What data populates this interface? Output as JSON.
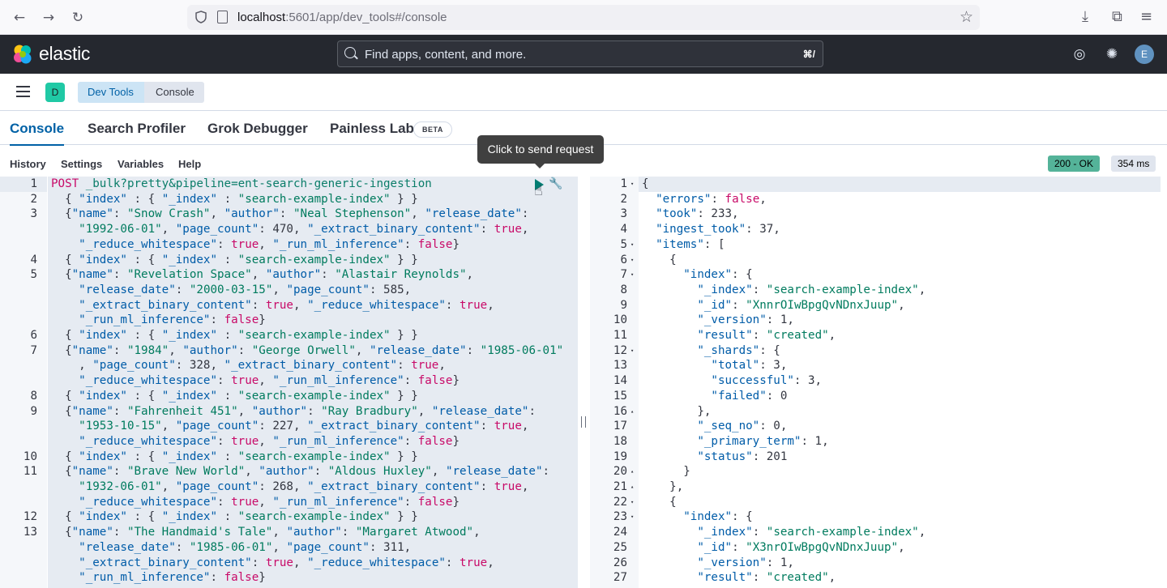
{
  "browser": {
    "url_host": "localhost",
    "url_rest": ":5601/app/dev_tools#/console"
  },
  "header": {
    "logo_text": "elastic",
    "search_placeholder": "Find apps, content, and more.",
    "search_shortcut": "⌘/",
    "avatar_initial": "E"
  },
  "breadcrumb": {
    "space_initial": "D",
    "items": [
      "Dev Tools",
      "Console"
    ]
  },
  "tabs": [
    {
      "label": "Console",
      "active": true
    },
    {
      "label": "Search Profiler",
      "active": false
    },
    {
      "label": "Grok Debugger",
      "active": false
    },
    {
      "label": "Painless Lab",
      "active": false
    }
  ],
  "beta_badge": "BETA",
  "console_menu": [
    "History",
    "Settings",
    "Variables",
    "Help"
  ],
  "tooltip": "Click to send request",
  "status": {
    "code": "200 - OK",
    "time": "354 ms"
  },
  "request_lines": [
    {
      "num": "1",
      "html": "<span class='m'>POST</span> <span class='url'>_bulk?pretty&pipeline=ent-search-generic-ingestion</span>"
    },
    {
      "num": "2",
      "html": "  { <span class='n'>\"index\"</span> : { <span class='n'>\"_index\"</span> : <span class='s'>\"search-example-index\"</span> } }"
    },
    {
      "num": "3",
      "html": "  {<span class='n'>\"name\"</span>: <span class='s'>\"Snow Crash\"</span>, <span class='n'>\"author\"</span>: <span class='s'>\"Neal Stephenson\"</span>, <span class='n'>\"release_date\"</span>:"
    },
    {
      "num": "",
      "html": "    <span class='s'>\"1992-06-01\"</span>, <span class='n'>\"page_count\"</span>: 470, <span class='n'>\"_extract_binary_content\"</span>: <span class='b'>true</span>,"
    },
    {
      "num": "",
      "html": "    <span class='n'>\"_reduce_whitespace\"</span>: <span class='b'>true</span>, <span class='n'>\"_run_ml_inference\"</span>: <span class='b'>false</span>}"
    },
    {
      "num": "4",
      "html": "  { <span class='n'>\"index\"</span> : { <span class='n'>\"_index\"</span> : <span class='s'>\"search-example-index\"</span> } }"
    },
    {
      "num": "5",
      "html": "  {<span class='n'>\"name\"</span>: <span class='s'>\"Revelation Space\"</span>, <span class='n'>\"author\"</span>: <span class='s'>\"Alastair Reynolds\"</span>,"
    },
    {
      "num": "",
      "html": "    <span class='n'>\"release_date\"</span>: <span class='s'>\"2000-03-15\"</span>, <span class='n'>\"page_count\"</span>: 585,"
    },
    {
      "num": "",
      "html": "    <span class='n'>\"_extract_binary_content\"</span>: <span class='b'>true</span>, <span class='n'>\"_reduce_whitespace\"</span>: <span class='b'>true</span>,"
    },
    {
      "num": "",
      "html": "    <span class='n'>\"_run_ml_inference\"</span>: <span class='b'>false</span>}"
    },
    {
      "num": "6",
      "html": "  { <span class='n'>\"index\"</span> : { <span class='n'>\"_index\"</span> : <span class='s'>\"search-example-index\"</span> } }"
    },
    {
      "num": "7",
      "html": "  {<span class='n'>\"name\"</span>: <span class='s'>\"1984\"</span>, <span class='n'>\"author\"</span>: <span class='s'>\"George Orwell\"</span>, <span class='n'>\"release_date\"</span>: <span class='s'>\"1985-06-01\"</span>"
    },
    {
      "num": "",
      "html": "    , <span class='n'>\"page_count\"</span>: 328, <span class='n'>\"_extract_binary_content\"</span>: <span class='b'>true</span>,"
    },
    {
      "num": "",
      "html": "    <span class='n'>\"_reduce_whitespace\"</span>: <span class='b'>true</span>, <span class='n'>\"_run_ml_inference\"</span>: <span class='b'>false</span>}"
    },
    {
      "num": "8",
      "html": "  { <span class='n'>\"index\"</span> : { <span class='n'>\"_index\"</span> : <span class='s'>\"search-example-index\"</span> } }"
    },
    {
      "num": "9",
      "html": "  {<span class='n'>\"name\"</span>: <span class='s'>\"Fahrenheit 451\"</span>, <span class='n'>\"author\"</span>: <span class='s'>\"Ray Bradbury\"</span>, <span class='n'>\"release_date\"</span>:"
    },
    {
      "num": "",
      "html": "    <span class='s'>\"1953-10-15\"</span>, <span class='n'>\"page_count\"</span>: 227, <span class='n'>\"_extract_binary_content\"</span>: <span class='b'>true</span>,"
    },
    {
      "num": "",
      "html": "    <span class='n'>\"_reduce_whitespace\"</span>: <span class='b'>true</span>, <span class='n'>\"_run_ml_inference\"</span>: <span class='b'>false</span>}"
    },
    {
      "num": "10",
      "html": "  { <span class='n'>\"index\"</span> : { <span class='n'>\"_index\"</span> : <span class='s'>\"search-example-index\"</span> } }"
    },
    {
      "num": "11",
      "html": "  {<span class='n'>\"name\"</span>: <span class='s'>\"Brave New World\"</span>, <span class='n'>\"author\"</span>: <span class='s'>\"Aldous Huxley\"</span>, <span class='n'>\"release_date\"</span>:"
    },
    {
      "num": "",
      "html": "    <span class='s'>\"1932-06-01\"</span>, <span class='n'>\"page_count\"</span>: 268, <span class='n'>\"_extract_binary_content\"</span>: <span class='b'>true</span>,"
    },
    {
      "num": "",
      "html": "    <span class='n'>\"_reduce_whitespace\"</span>: <span class='b'>true</span>, <span class='n'>\"_run_ml_inference\"</span>: <span class='b'>false</span>}"
    },
    {
      "num": "12",
      "html": "  { <span class='n'>\"index\"</span> : { <span class='n'>\"_index\"</span> : <span class='s'>\"search-example-index\"</span> } }"
    },
    {
      "num": "13",
      "html": "  {<span class='n'>\"name\"</span>: <span class='s'>\"The Handmaid's Tale\"</span>, <span class='n'>\"author\"</span>: <span class='s'>\"Margaret Atwood\"</span>,"
    },
    {
      "num": "",
      "html": "    <span class='n'>\"release_date\"</span>: <span class='s'>\"1985-06-01\"</span>, <span class='n'>\"page_count\"</span>: 311,"
    },
    {
      "num": "",
      "html": "    <span class='n'>\"_extract_binary_content\"</span>: <span class='b'>true</span>, <span class='n'>\"_reduce_whitespace\"</span>: <span class='b'>true</span>,"
    },
    {
      "num": "",
      "html": "    <span class='n'>\"_run_ml_inference\"</span>: <span class='b'>false</span>}"
    }
  ],
  "response_lines": [
    {
      "num": "1",
      "fold": "▾",
      "html": "{"
    },
    {
      "num": "2",
      "fold": "",
      "html": "  <span class='n'>\"errors\"</span>: <span class='b'>false</span>,"
    },
    {
      "num": "3",
      "fold": "",
      "html": "  <span class='n'>\"took\"</span>: 233,"
    },
    {
      "num": "4",
      "fold": "",
      "html": "  <span class='n'>\"ingest_took\"</span>: 37,"
    },
    {
      "num": "5",
      "fold": "▾",
      "html": "  <span class='n'>\"items\"</span>: ["
    },
    {
      "num": "6",
      "fold": "▾",
      "html": "    {"
    },
    {
      "num": "7",
      "fold": "▾",
      "html": "      <span class='n'>\"index\"</span>: {"
    },
    {
      "num": "8",
      "fold": "",
      "html": "        <span class='n'>\"_index\"</span>: <span class='s'>\"search-example-index\"</span>,"
    },
    {
      "num": "9",
      "fold": "",
      "html": "        <span class='n'>\"_id\"</span>: <span class='s'>\"XnnrOIwBpgQvNDnxJuup\"</span>,"
    },
    {
      "num": "10",
      "fold": "",
      "html": "        <span class='n'>\"_version\"</span>: 1,"
    },
    {
      "num": "11",
      "fold": "",
      "html": "        <span class='n'>\"result\"</span>: <span class='s'>\"created\"</span>,"
    },
    {
      "num": "12",
      "fold": "▾",
      "html": "        <span class='n'>\"_shards\"</span>: {"
    },
    {
      "num": "13",
      "fold": "",
      "html": "          <span class='n'>\"total\"</span>: 3,"
    },
    {
      "num": "14",
      "fold": "",
      "html": "          <span class='n'>\"successful\"</span>: 3,"
    },
    {
      "num": "15",
      "fold": "",
      "html": "          <span class='n'>\"failed\"</span>: 0"
    },
    {
      "num": "16",
      "fold": "▴",
      "html": "        },"
    },
    {
      "num": "17",
      "fold": "",
      "html": "        <span class='n'>\"_seq_no\"</span>: 0,"
    },
    {
      "num": "18",
      "fold": "",
      "html": "        <span class='n'>\"_primary_term\"</span>: 1,"
    },
    {
      "num": "19",
      "fold": "",
      "html": "        <span class='n'>\"status\"</span>: 201"
    },
    {
      "num": "20",
      "fold": "▴",
      "html": "      }"
    },
    {
      "num": "21",
      "fold": "▴",
      "html": "    },"
    },
    {
      "num": "22",
      "fold": "▾",
      "html": "    {"
    },
    {
      "num": "23",
      "fold": "▾",
      "html": "      <span class='n'>\"index\"</span>: {"
    },
    {
      "num": "24",
      "fold": "",
      "html": "        <span class='n'>\"_index\"</span>: <span class='s'>\"search-example-index\"</span>,"
    },
    {
      "num": "25",
      "fold": "",
      "html": "        <span class='n'>\"_id\"</span>: <span class='s'>\"X3nrOIwBpgQvNDnxJuup\"</span>,"
    },
    {
      "num": "26",
      "fold": "",
      "html": "        <span class='n'>\"_version\"</span>: 1,"
    },
    {
      "num": "27",
      "fold": "",
      "html": "        <span class='n'>\"result\"</span>: <span class='s'>\"created\"</span>,"
    }
  ]
}
